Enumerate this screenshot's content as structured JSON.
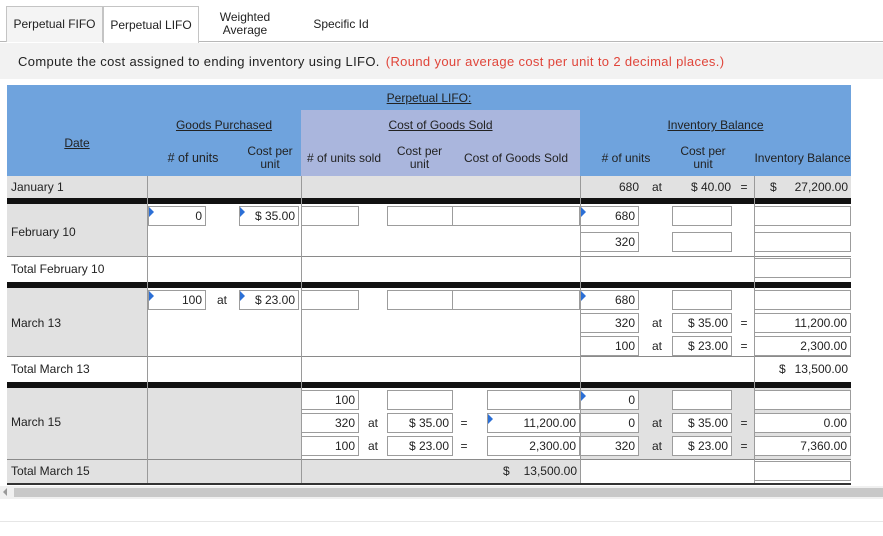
{
  "tabs": [
    {
      "label": "Perpetual FIFO"
    },
    {
      "label": "Perpetual LIFO"
    },
    {
      "label": "Weighted Average"
    },
    {
      "label": "Specific Id"
    }
  ],
  "question": {
    "text": "Compute the cost assigned to ending inventory using LIFO.",
    "note": "(Round your average cost per unit to 2 decimal places.)"
  },
  "table": {
    "title": "Perpetual LIFO:",
    "groups": {
      "purchased": "Goods Purchased",
      "sold": "Cost of Goods Sold",
      "balance": "Inventory Balance"
    },
    "cols": {
      "date": "Date",
      "units": "# of units",
      "cost_per_unit": "Cost per unit",
      "units_sold": "# of units sold",
      "cogs": "Cost of Goods Sold",
      "inv_balance": "Inventory Balance"
    },
    "at": "at",
    "eq": "=",
    "dollar": "$",
    "rows": {
      "jan1": {
        "date": "January 1",
        "bal_units": "680",
        "bal_cost": "$ 40.00",
        "bal_total": "27,200.00"
      },
      "feb10": {
        "date": "February 10",
        "pur_units": "0",
        "pur_cost": "$ 35.00",
        "bal_units_1": "680",
        "bal_units_2": "320"
      },
      "feb_total": {
        "date": "Total February 10"
      },
      "mar13": {
        "date": "March 13",
        "pur_units": "100",
        "pur_cost": "$ 23.00",
        "bal_units_1": "680",
        "bal_units_2": "320",
        "bal_units_3": "100",
        "bal_cost_2": "$ 35.00",
        "bal_cost_3": "$ 23.00",
        "bal_total_2": "11,200.00",
        "bal_total_3": "2,300.00"
      },
      "mar13_total": {
        "date": "Total March 13",
        "bal_total": "13,500.00"
      },
      "mar15": {
        "date": "March 15",
        "sold_units_1": "100",
        "sold_units_2": "320",
        "sold_units_3": "100",
        "sold_cost_2": "$ 35.00",
        "sold_cost_3": "$ 23.00",
        "cogs_2": "11,200.00",
        "cogs_3": "2,300.00",
        "bal_units_1": "0",
        "bal_units_2": "0",
        "bal_units_3": "320",
        "bal_cost_2": "$ 35.00",
        "bal_cost_3": "$ 23.00",
        "bal_total_2": "0.00",
        "bal_total_3": "7,360.00"
      },
      "mar15_total": {
        "date": "Total March 15",
        "cogs_total": "13,500.00"
      }
    }
  },
  "colors": {
    "header_blue": "#6fa3dd",
    "header_lavender": "#aab6dd",
    "note_red": "#e0453a",
    "input_flag": "#2b6fd6"
  }
}
